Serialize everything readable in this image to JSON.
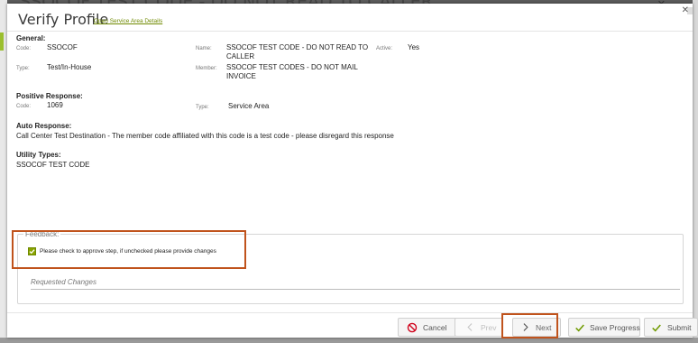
{
  "background": {
    "window_title": "SSOCOF TEST CODE - DO NOT READ TO CALLER"
  },
  "modal": {
    "title": "Verify Profile",
    "link": "Open Service Area Details"
  },
  "general": {
    "heading": "General:",
    "code_label": "Code:",
    "code_value": "SSOCOF",
    "name_label": "Name:",
    "name_value_line1": "SSOCOF TEST CODE - DO NOT READ TO",
    "name_value_line2": "CALLER",
    "active_label": "Active:",
    "active_value": "Yes",
    "type_label": "Type:",
    "type_value": "Test/In-House",
    "member_label": "Member:",
    "member_value_line1": "SSOCOF TEST CODES - DO NOT MAIL",
    "member_value_line2": "INVOICE"
  },
  "positive_response": {
    "heading": "Positive Response:",
    "code_label": "Code:",
    "code_value": "1069",
    "type_label": "Type:",
    "type_value": "Service Area"
  },
  "auto_response": {
    "heading": "Auto Response:",
    "text": "Call Center Test Destination - The member code affiliated with this code is a test code - please disregard this response"
  },
  "utility_types": {
    "heading": "Utility Types:",
    "text": "SSOCOF TEST CODE"
  },
  "feedback": {
    "legend": "Feedback:",
    "checkbox_label": "Please check to approve step, if unchecked please provide changes",
    "checked": true,
    "requested_changes_label": "Requested Changes"
  },
  "buttons": {
    "cancel": "Cancel",
    "prev": "Prev",
    "next": "Next",
    "save": "Save Progress",
    "submit": "Submit"
  },
  "icons": {
    "cancel": "ban-icon",
    "prev": "chevron-left-icon",
    "next": "chevron-right-icon",
    "save": "check-icon",
    "submit": "check-icon",
    "close": "close-icon"
  },
  "colors": {
    "accent": "#8aa300",
    "highlight": "#c0531c",
    "cancel_icon": "#d0021b",
    "check_icon": "#6f9a00"
  }
}
